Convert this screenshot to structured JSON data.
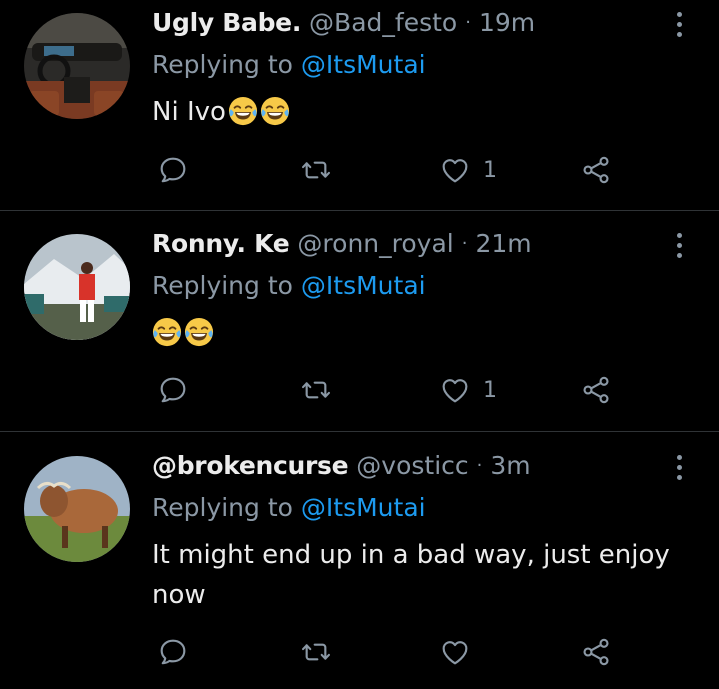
{
  "tweets": [
    {
      "display_name": "Ugly Babe.",
      "handle": "@Bad_festo",
      "separator": "·",
      "time": "19m",
      "replying_prefix": "Replying to",
      "replying_to": "@ItsMutai",
      "text": "Ni Ivo",
      "emoji": [
        "face-with-tears-of-joy",
        "face-with-tears-of-joy"
      ],
      "like_count": "1",
      "avatar": "car-interior-photo"
    },
    {
      "display_name": "Ronny. Ke",
      "handle": "@ronn_royal",
      "separator": "·",
      "time": "21m",
      "replying_prefix": "Replying to",
      "replying_to": "@ItsMutai",
      "text": "",
      "emoji": [
        "face-with-tears-of-joy",
        "face-with-tears-of-joy"
      ],
      "like_count": "1",
      "avatar": "man-in-red-jacket-photo"
    },
    {
      "display_name": "@brokencurse",
      "handle": "@vosticc",
      "separator": "·",
      "time": "3m",
      "replying_prefix": "Replying to",
      "replying_to": "@ItsMutai",
      "text": "It might end up in a bad way, just enjoy now",
      "emoji": [],
      "like_count": "",
      "avatar": "bull-photo"
    }
  ],
  "colors": {
    "background": "#000000",
    "name": "#ececec",
    "muted": "#8b98a5",
    "mention": "#1d9bf0",
    "divider": "#2f3336"
  }
}
